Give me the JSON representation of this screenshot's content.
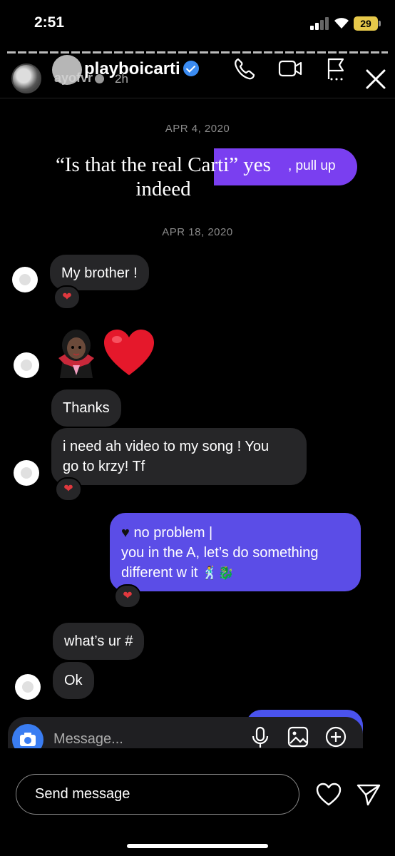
{
  "status_bar": {
    "time": "2:51",
    "battery": "29"
  },
  "story": {
    "username": "ayofvr",
    "time_ago": "2h"
  },
  "chat": {
    "username": "playboicarti"
  },
  "dates": {
    "first": "APR 4, 2020",
    "second": "APR 18, 2020"
  },
  "story_overlay": {
    "line1": "“Is that the real Carti” yes",
    "line2": "indeed",
    "pullup": ", pull up"
  },
  "messages": {
    "m1": "My brother !",
    "m2": "Thanks",
    "m3_line1": "i need ah video to my song ! You",
    "m3_line2": "go to krzy! Tf",
    "m4_line1": "no problem |",
    "m4_line2": "you in the A, let’s do something",
    "m4_line3": "different w it",
    "m5": "what’s ur #",
    "m6": "Ok"
  },
  "reaction_icon": "red-heart",
  "composer": {
    "placeholder": "Message..."
  },
  "footer": {
    "send_placeholder": "Send message"
  },
  "colors": {
    "my_bubble": "#5b4de7",
    "their_bubble": "#262628",
    "pull_up": "#7a3ff0",
    "verified": "#3a8bf2"
  }
}
